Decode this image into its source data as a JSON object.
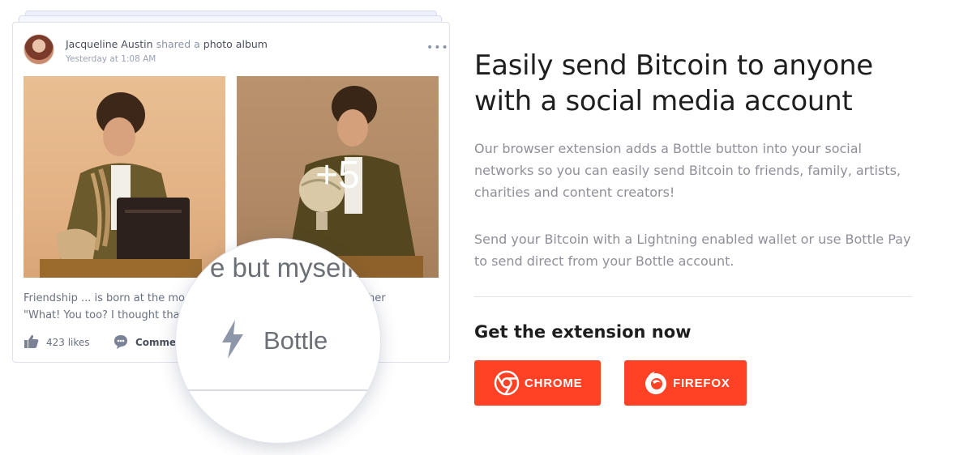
{
  "post": {
    "author": "Jacqueline Austin",
    "action": "shared a",
    "object": "photo album",
    "time": "Yesterday at 1:08 AM",
    "more": "•••",
    "extra_photos": "+5",
    "caption_line1_start": "Friendship ... is born at the mo",
    "caption_line1_end": "her",
    "caption_line2": "\"What! You too? I thought tha",
    "likes": "423 likes",
    "comments": "Commen"
  },
  "magnifier": {
    "text": "e but myself.",
    "bottle_label": "Bottle"
  },
  "promo": {
    "headline": "Easily send Bitcoin to anyone with a social media account",
    "paragraph1": "Our browser extension adds a Bottle button into your social networks so you can easily send Bitcoin to friends, family, artists, charities and content creators!",
    "paragraph2": "Send your Bitcoin with a Lightning enabled wallet or use Bottle Pay to send direct from your Bottle account.",
    "subheading": "Get the extension now",
    "chrome_label": "CHROME",
    "firefox_label": "FIREFOX"
  },
  "colors": {
    "accent": "#ff4226",
    "headline": "#1e1e1e",
    "body_text": "#8f8f99"
  }
}
